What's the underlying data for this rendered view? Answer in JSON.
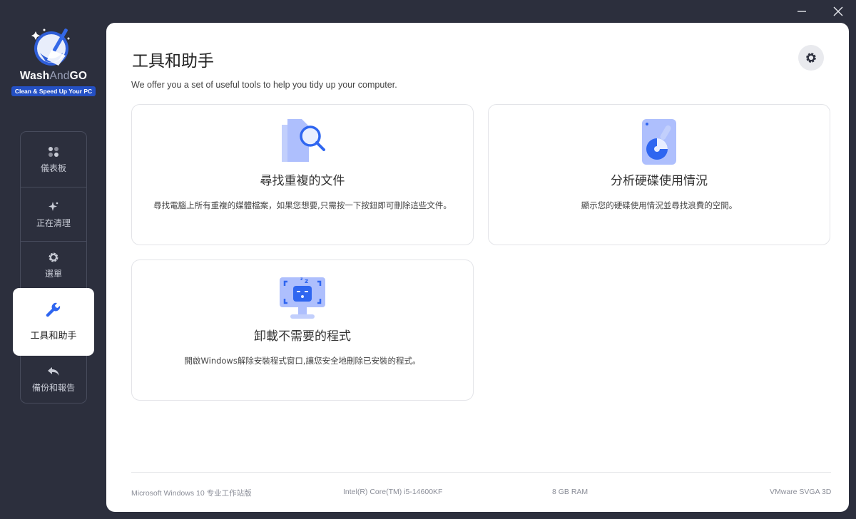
{
  "app": {
    "name_part1": "Wash",
    "name_part2": "And",
    "name_part3": "GO",
    "tagline": "Clean & Speed Up Your PC"
  },
  "colors": {
    "accent": "#2f66f0",
    "sidebar_bg": "#2c2f3d",
    "illustration_light": "#aebffd"
  },
  "sidebar": {
    "items": [
      {
        "label": "儀表板",
        "icon": "dashboard-icon"
      },
      {
        "label": "正在清理",
        "icon": "sparkle-icon"
      },
      {
        "label": "選單",
        "icon": "gear-icon"
      },
      {
        "label": "工具和助手",
        "icon": "wrench-icon",
        "active": true
      },
      {
        "label": "備份和報告",
        "icon": "undo-arrow-icon"
      }
    ]
  },
  "main": {
    "title": "工具和助手",
    "description": "We offer you a set of useful tools to help you tidy up your computer.",
    "cards": [
      {
        "title": "尋找重複的文件",
        "description": "尋找電腦上所有重複的媒體檔案，如果您想要,只需按一下按鈕即可刪除這些文件。",
        "icon": "duplicate-files-search-icon"
      },
      {
        "title": "分析硬碟使用情況",
        "description": "顯示您的硬碟使用情況並尋找浪費的空間。",
        "icon": "disk-usage-icon"
      },
      {
        "title": "卸載不需要的程式",
        "description": "開啟Windows解除安裝程式窗口,讓您安全地刪除已安裝的程式。",
        "icon": "uninstall-program-icon"
      }
    ]
  },
  "footer": {
    "os": "Microsoft Windows 10 专业工作站版",
    "cpu": "Intel(R) Core(TM) i5-14600KF",
    "ram": "8 GB RAM",
    "gpu": "VMware SVGA 3D"
  }
}
